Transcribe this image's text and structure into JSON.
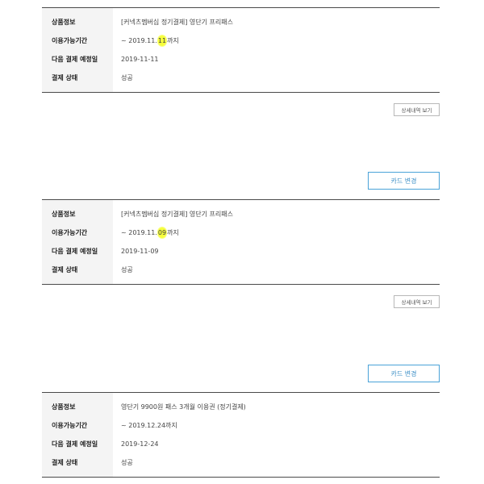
{
  "labels": {
    "product": "상품정보",
    "period": "이용가능기간",
    "next_payment": "다음 결제 예정일",
    "status": "결제 상태"
  },
  "detail_button_label": "상세내역 보기",
  "card_button_label": "카드 변경",
  "highlight_color": "#f6ff3c",
  "accent_color": "#4aa3d8",
  "subscriptions": [
    {
      "product": "[커넥츠멤버십 정기결제] 영단기 프리패스",
      "period_prefix": "~ 2019.11.",
      "period_highlight": "11",
      "period_suffix": "까지",
      "next_payment": "2019-11-11",
      "status": "성공"
    },
    {
      "product": "[커넥츠멤버십 정기결제] 영단기 프리패스",
      "period_prefix": "~ 2019.11.",
      "period_highlight": "09",
      "period_suffix": "까지",
      "next_payment": "2019-11-09",
      "status": "성공"
    },
    {
      "product": "영단기 9900원 패스 3개월 이용권 (정기결제)",
      "period": "~ 2019.12.24까지",
      "next_payment": "2019-12-24",
      "status": "성공"
    }
  ]
}
